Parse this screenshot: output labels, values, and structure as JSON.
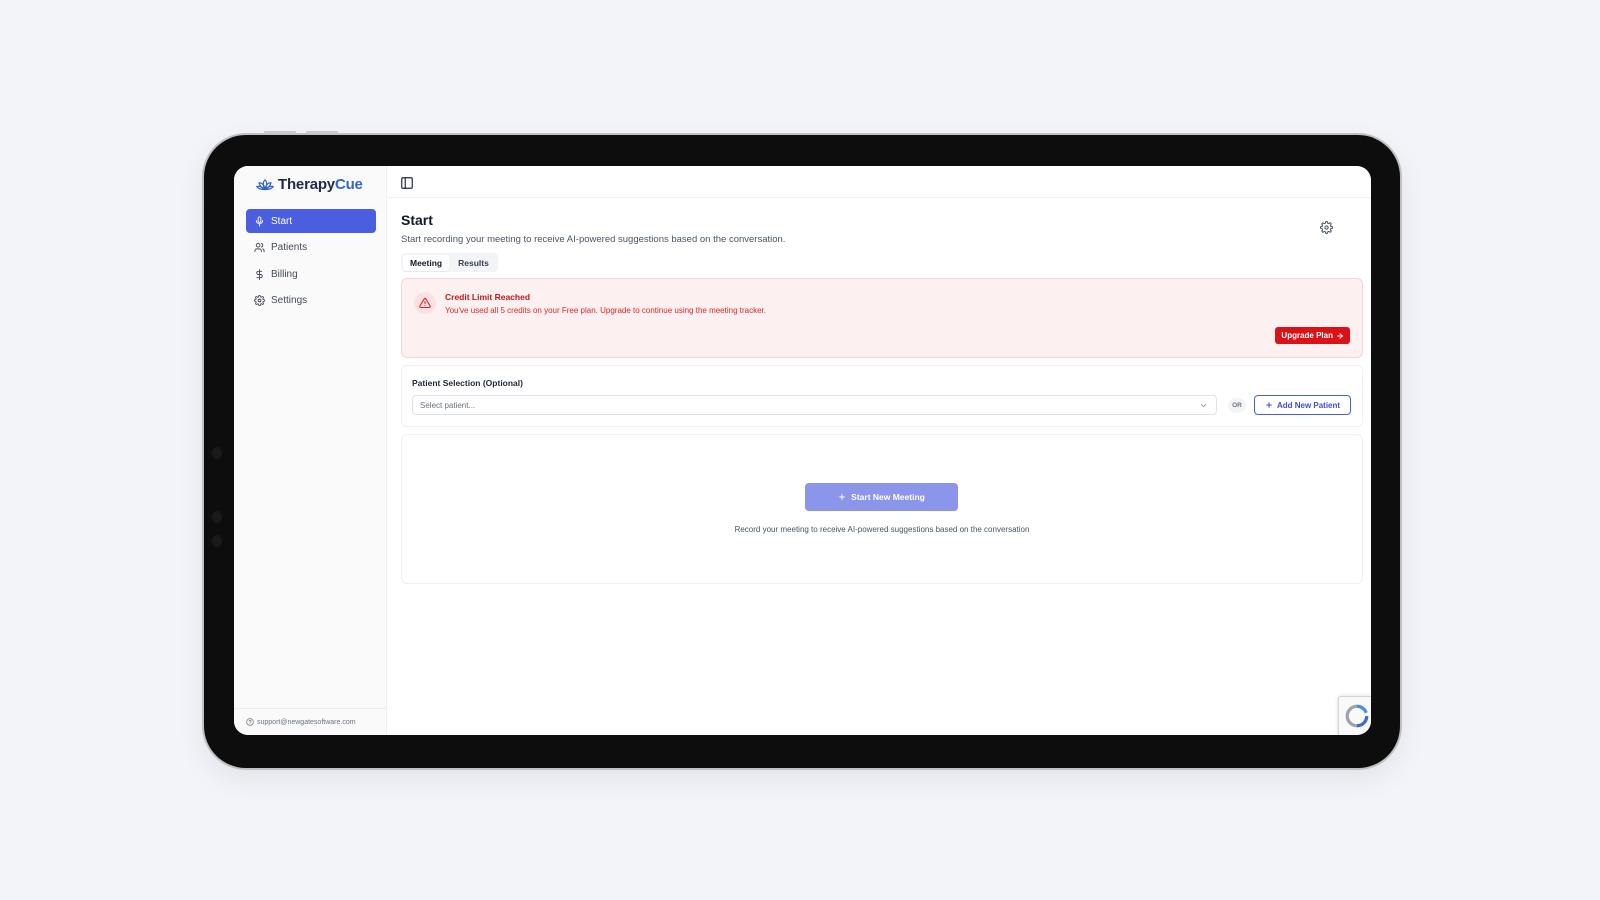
{
  "app": {
    "name_part1": "Therapy",
    "name_part2": "Cue",
    "brand_color": "#2f66c8",
    "accent_color": "#4c5ee0",
    "danger_color": "#dc1118"
  },
  "sidebar": {
    "items": [
      {
        "label": "Start",
        "icon": "microphone-icon",
        "active": true
      },
      {
        "label": "Patients",
        "icon": "users-icon",
        "active": false
      },
      {
        "label": "Billing",
        "icon": "dollar-icon",
        "active": false
      },
      {
        "label": "Settings",
        "icon": "gear-icon",
        "active": false
      }
    ],
    "support_email": "support@newgatesoftware.com"
  },
  "header": {
    "title": "Start",
    "subtitle": "Start recording your meeting to receive AI-powered suggestions based on the conversation."
  },
  "tabs": [
    {
      "label": "Meeting",
      "active": true
    },
    {
      "label": "Results",
      "active": false
    }
  ],
  "alert": {
    "title": "Credit Limit Reached",
    "message": "You've used all 5 credits on your Free plan. Upgrade to continue using the meeting tracker.",
    "button_label": "Upgrade Plan"
  },
  "patient_selection": {
    "label": "Patient Selection (Optional)",
    "placeholder": "Select patient...",
    "or_label": "OR",
    "add_button_label": "Add New Patient"
  },
  "meeting": {
    "start_button_label": "Start New Meeting",
    "hint": "Record your meeting to receive AI-powered suggestions based on the conversation"
  }
}
